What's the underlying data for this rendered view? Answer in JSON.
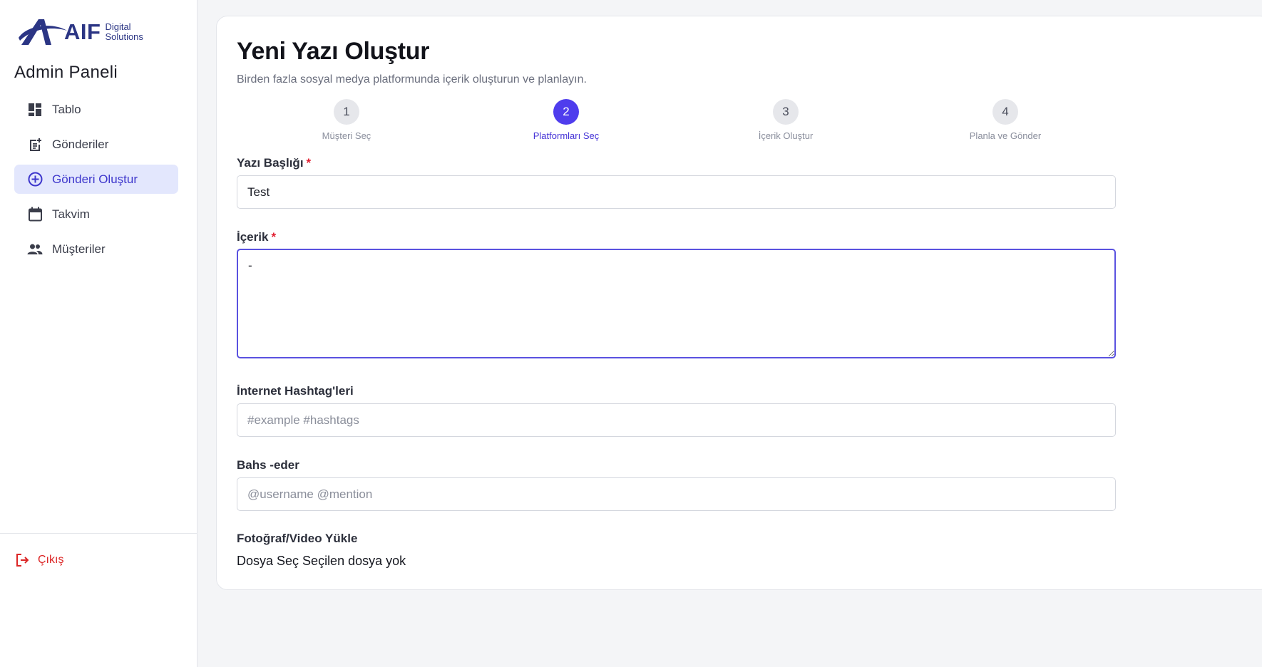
{
  "brand": {
    "name": "AIF",
    "sub_line1": "Digital",
    "sub_line2": "Solutions"
  },
  "sidebar": {
    "title": "Admin Paneli",
    "items": [
      {
        "label": "Tablo",
        "icon": "dashboard-icon"
      },
      {
        "label": "Gönderiler",
        "icon": "post-add-icon"
      },
      {
        "label": "Gönderi Oluştur",
        "icon": "add-circle-icon",
        "active": true
      },
      {
        "label": "Takvim",
        "icon": "calendar-icon"
      },
      {
        "label": "Müşteriler",
        "icon": "people-icon"
      }
    ],
    "logout_label": "Çıkış"
  },
  "page": {
    "title": "Yeni Yazı Oluştur",
    "subtitle": "Birden fazla sosyal medya platformunda içerik oluşturun ve planlayın."
  },
  "stepper": {
    "active_step": 2,
    "steps": [
      {
        "number": "1",
        "label": "Müşteri Seç"
      },
      {
        "number": "2",
        "label": "Platformları Seç"
      },
      {
        "number": "3",
        "label": "İçerik Oluştur"
      },
      {
        "number": "4",
        "label": "Planla ve Gönder"
      }
    ]
  },
  "form": {
    "title_label": "Yazı Başlığı",
    "title_value": "Test",
    "content_label": "İçerik",
    "content_value": "-",
    "hashtags_label": "İnternet Hashtag'leri",
    "hashtags_placeholder": "#example #hashtags",
    "mentions_label": "Bahs -eder",
    "mentions_placeholder": "@username @mention",
    "upload_label": "Fotoğraf/Video Yükle",
    "upload_button": "Dosya Seç",
    "upload_status": "Seçilen dosya yok",
    "required_mark": "*"
  },
  "colors": {
    "accent": "#4f3ded",
    "active_nav_bg": "#e3e7fd",
    "danger": "#dc2626",
    "brand": "#2b3584"
  }
}
